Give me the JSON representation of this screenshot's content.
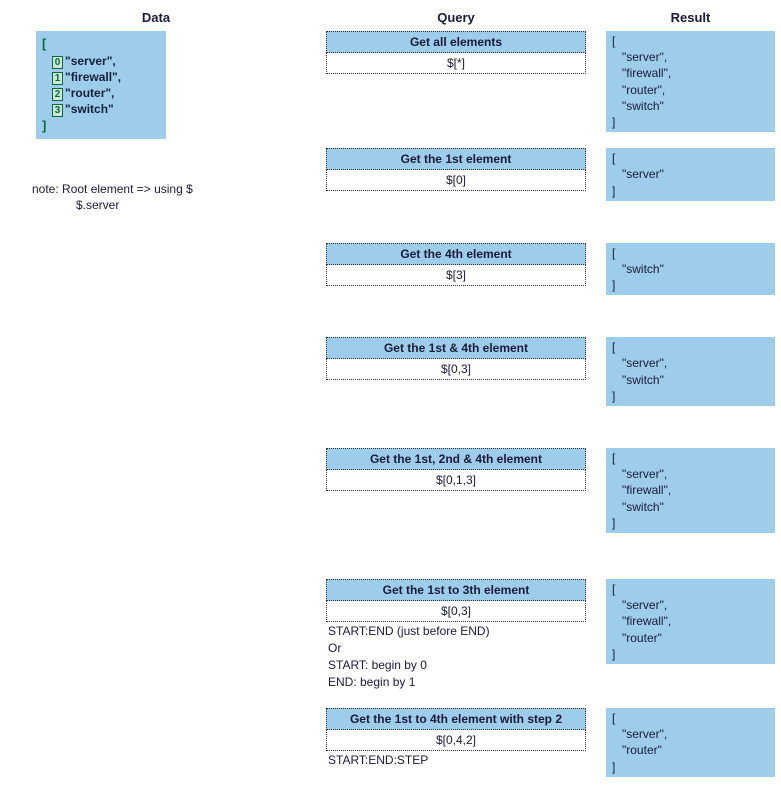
{
  "headers": {
    "data": "Data",
    "query": "Query",
    "result": "Result"
  },
  "data_items": [
    {
      "idx": "0",
      "val": "server",
      "trail": ","
    },
    {
      "idx": "1",
      "val": "firewall",
      "trail": ","
    },
    {
      "idx": "2",
      "val": "router",
      "trail": ","
    },
    {
      "idx": "3",
      "val": "switch",
      "trail": ""
    }
  ],
  "note": {
    "line1": "note: Root element => using $",
    "line2": "$.server"
  },
  "sections": [
    {
      "gap_before": 0,
      "query": {
        "title": "Get all elements",
        "expr": "$[*]",
        "notes": []
      },
      "result": [
        "\"server\",",
        "\"firewall\",",
        "\"router\",",
        "\"switch\""
      ],
      "gap_after_query": 50
    },
    {
      "gap_before": 10,
      "query": {
        "title": "Get the 1st element",
        "expr": "$[0]",
        "notes": []
      },
      "result": [
        "\"server\""
      ],
      "gap_after_query": 0
    },
    {
      "gap_before": 36,
      "query": {
        "title": "Get the 4th element",
        "expr": "$[3]",
        "notes": []
      },
      "result": [
        "\"switch\""
      ],
      "gap_after_query": 0
    },
    {
      "gap_before": 36,
      "query": {
        "title": "Get the 1st & 4th element",
        "expr": "$[0,3]",
        "notes": []
      },
      "result": [
        "\"server\",",
        "\"switch\""
      ],
      "gap_after_query": 0
    },
    {
      "gap_before": 36,
      "query": {
        "title": "Get the 1st, 2nd & 4th element",
        "expr": "$[0,1,3]",
        "notes": []
      },
      "result": [
        "\"server\",",
        "\"firewall\",",
        "\"switch\""
      ],
      "gap_after_query": 0
    },
    {
      "gap_before": 40,
      "query": {
        "title": "Get the 1st to 3th element",
        "expr": "$[0,3]",
        "notes": [
          "START:END (just before END)",
          "Or",
          "START: begin by 0",
          "END: begin by 1"
        ]
      },
      "result": [
        "\"server\",",
        "\"firewall\",",
        "\"router\""
      ],
      "gap_after_query": 0
    },
    {
      "gap_before": 2,
      "query": {
        "title": "Get the 1st to 4th element with step 2",
        "expr": "$[0,4,2]",
        "notes": [
          "START:END:STEP"
        ]
      },
      "result": [
        "\"server\",",
        "\"router\""
      ],
      "gap_after_query": 0
    }
  ]
}
